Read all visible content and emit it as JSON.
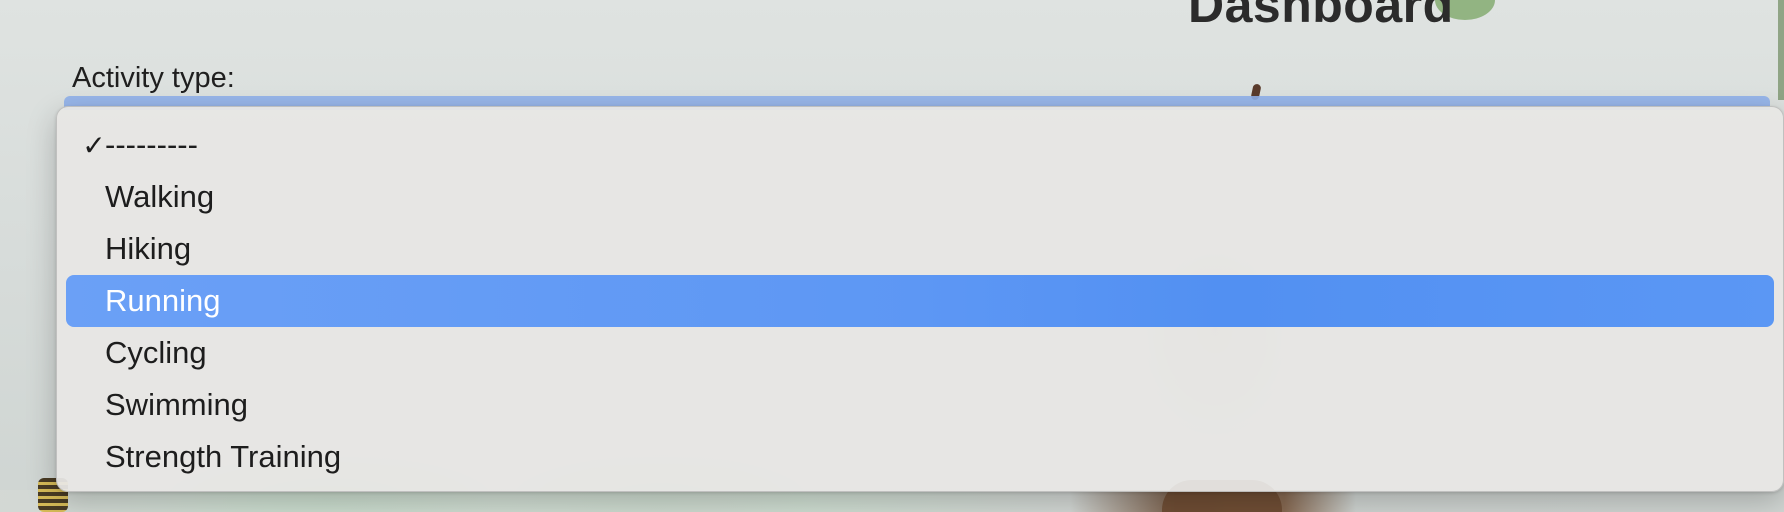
{
  "page": {
    "heading": "Dashboard"
  },
  "form": {
    "activity_label": "Activity type:"
  },
  "dropdown": {
    "selected_value": "---------",
    "highlighted_option": "Running",
    "highlight_color": "#5b97f4",
    "check_icon": "checkmark-icon",
    "check_glyph": "✓",
    "options": [
      {
        "label": "---------",
        "checked": true
      },
      {
        "label": "Walking"
      },
      {
        "label": "Hiking"
      },
      {
        "label": "Running",
        "highlighted": true
      },
      {
        "label": "Cycling"
      },
      {
        "label": "Swimming"
      },
      {
        "label": "Strength Training"
      }
    ]
  }
}
